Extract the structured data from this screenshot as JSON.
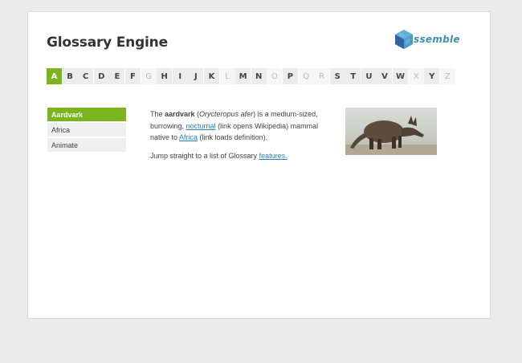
{
  "header": {
    "title": "Glossary Engine",
    "logo_text": "ssemble",
    "logo_icon": "hex-cube-icon"
  },
  "alphabet": [
    {
      "letter": "A",
      "state": "active"
    },
    {
      "letter": "B",
      "state": "enabled"
    },
    {
      "letter": "C",
      "state": "enabled"
    },
    {
      "letter": "D",
      "state": "enabled"
    },
    {
      "letter": "E",
      "state": "enabled"
    },
    {
      "letter": "F",
      "state": "enabled"
    },
    {
      "letter": "G",
      "state": "disabled"
    },
    {
      "letter": "H",
      "state": "enabled"
    },
    {
      "letter": "I",
      "state": "enabled"
    },
    {
      "letter": "J",
      "state": "enabled"
    },
    {
      "letter": "K",
      "state": "enabled"
    },
    {
      "letter": "L",
      "state": "disabled"
    },
    {
      "letter": "M",
      "state": "enabled"
    },
    {
      "letter": "N",
      "state": "enabled"
    },
    {
      "letter": "O",
      "state": "disabled"
    },
    {
      "letter": "P",
      "state": "enabled"
    },
    {
      "letter": "Q",
      "state": "disabled"
    },
    {
      "letter": "R",
      "state": "disabled"
    },
    {
      "letter": "S",
      "state": "enabled"
    },
    {
      "letter": "T",
      "state": "enabled"
    },
    {
      "letter": "U",
      "state": "enabled"
    },
    {
      "letter": "V",
      "state": "enabled"
    },
    {
      "letter": "W",
      "state": "enabled"
    },
    {
      "letter": "X",
      "state": "disabled"
    },
    {
      "letter": "Y",
      "state": "enabled"
    },
    {
      "letter": "Z",
      "state": "disabled"
    }
  ],
  "sidebar": {
    "items": [
      {
        "label": "Aardvark",
        "active": true
      },
      {
        "label": "Africa",
        "active": false
      },
      {
        "label": "Animate",
        "active": false
      }
    ]
  },
  "content": {
    "p1_the": "The ",
    "p1_term": "aardvark",
    "p1_open": " (",
    "p1_sci": "Orycteropus afer",
    "p1_mid": ") is a medium-sized, burrowing, ",
    "p1_link1": "nocturnal",
    "p1_after1": " (link opens Wikipedia) mammal native to ",
    "p1_link2": "Africa",
    "p1_after2": " (link loads definition).",
    "p2_text": "Jump straight to a list of Glossary ",
    "p2_link": "features."
  },
  "image": {
    "subject": "aardvark-photo"
  },
  "colors": {
    "accent": "#7ab51d",
    "link": "#2a84b8",
    "logo": "#3e8fb0"
  }
}
